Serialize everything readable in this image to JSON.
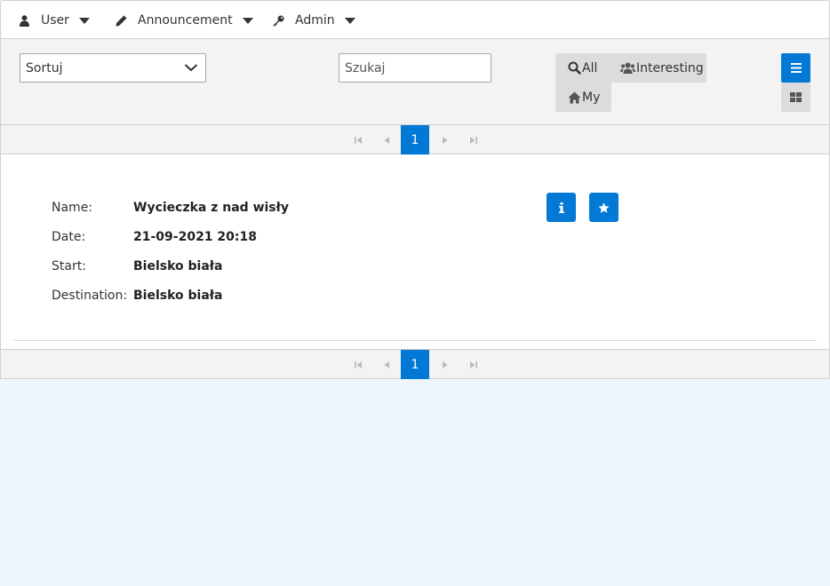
{
  "menu": {
    "user_label": "User",
    "announcement_label": "Announcement",
    "admin_label": "Admin"
  },
  "toolbar": {
    "sort_value": "Sortuj",
    "search_placeholder": "Szukaj",
    "filter_all": "All",
    "filter_interesting": "Interesting",
    "filter_my": "My"
  },
  "pager": {
    "top_current_page": "1",
    "bottom_current_page": "1"
  },
  "record": {
    "name_label": "Name:",
    "name_value": "Wycieczka z nad wisły",
    "date_label": "Date:",
    "date_value": "21-09-2021 20:18",
    "start_label": "Start:",
    "start_value": "Bielsko biała",
    "destination_label": "Destination:",
    "destination_value": "Bielsko biała"
  },
  "colors": {
    "accent": "#0379d6",
    "toolbar_bg": "#f3f3f3",
    "page_bg": "#eef6fd",
    "filter_bg": "#dcdcdc"
  },
  "icons": [
    "user-icon",
    "pencil-icon",
    "key-icon",
    "caret-down-icon",
    "chevron-down-icon",
    "search-icon",
    "users-icon",
    "home-icon",
    "list-icon",
    "grid-icon",
    "first-page-icon",
    "prev-page-icon",
    "next-page-icon",
    "last-page-icon",
    "info-icon",
    "star-icon"
  ]
}
